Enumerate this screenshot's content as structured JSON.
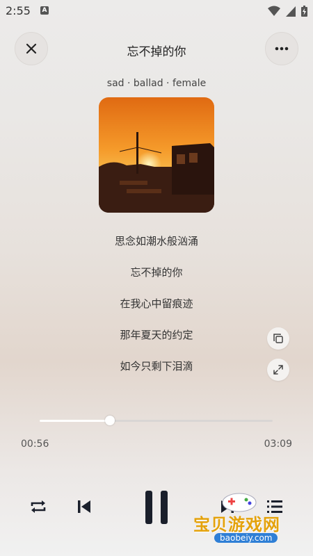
{
  "status_bar": {
    "time": "2:55",
    "a_badge": "A"
  },
  "player": {
    "title": "忘不掉的你",
    "tags": "sad · ballad · female"
  },
  "lyrics": [
    "思念如潮水般汹涌",
    "忘不掉的你",
    "在我心中留痕迹",
    "那年夏天的约定",
    "如今只剩下泪滴"
  ],
  "progress": {
    "current": "00:56",
    "total": "03:09",
    "fraction": 0.3
  },
  "watermark": {
    "text": "宝贝游戏网",
    "url": "baobeiy.com"
  },
  "colors": {
    "accent": "#1a1f2b",
    "watermark": "#e4a20b"
  }
}
